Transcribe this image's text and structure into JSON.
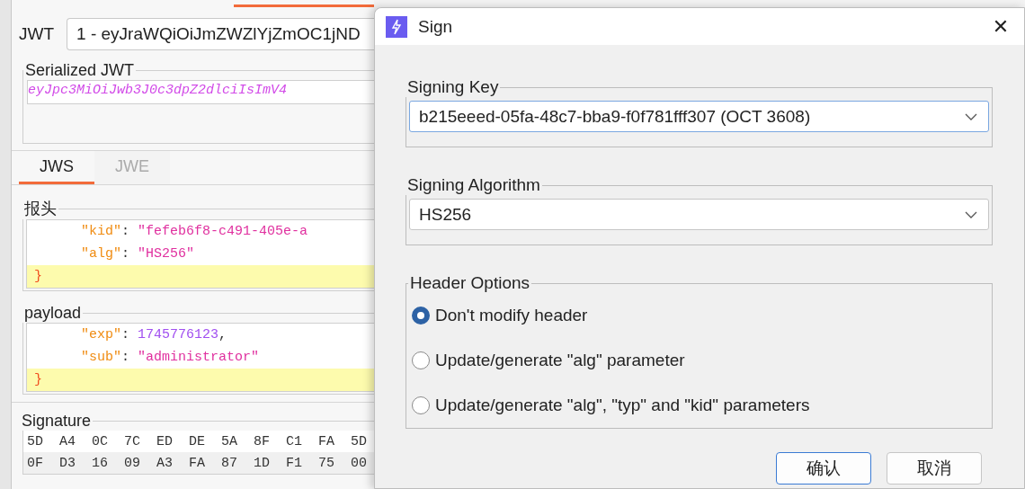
{
  "editor": {
    "jwt_selector": {
      "label": "JWT",
      "value": "1 - eyJraWQiOiJmZWZlYjZmOC1jND"
    },
    "serialized": {
      "title": "Serialized JWT",
      "value": "eyJpc3MiOiJwb3J0c3dpZ2dlciIsImV4"
    },
    "tabs": [
      {
        "label": "JWS",
        "selected": true
      },
      {
        "label": "JWE",
        "selected": false
      }
    ],
    "sections": [
      {
        "title": "报头",
        "lines": [
          {
            "kind": "pair",
            "highlighted": false,
            "tokens": [
              {
                "kind": "key",
                "text": "\"kid\""
              },
              {
                "kind": "punct",
                "text": ":"
              },
              {
                "kind": "string",
                "text": "\"fefeb6f8-c491-405e-a"
              }
            ]
          },
          {
            "kind": "pair",
            "highlighted": false,
            "tokens": [
              {
                "kind": "key",
                "text": "\"alg\""
              },
              {
                "kind": "punct",
                "text": ":"
              },
              {
                "kind": "string",
                "text": "\"HS256\""
              }
            ]
          },
          {
            "kind": "brace",
            "highlighted": true,
            "tokens": [
              {
                "kind": "brace",
                "text": "}"
              }
            ]
          }
        ]
      },
      {
        "title": "payload",
        "lines": [
          {
            "kind": "pair",
            "highlighted": false,
            "tokens": [
              {
                "kind": "key",
                "text": "\"exp\""
              },
              {
                "kind": "punct",
                "text": ":"
              },
              {
                "kind": "number",
                "text": "1745776123"
              },
              {
                "kind": "punct",
                "text": ","
              }
            ]
          },
          {
            "kind": "pair",
            "highlighted": false,
            "tokens": [
              {
                "kind": "key",
                "text": "\"sub\""
              },
              {
                "kind": "punct",
                "text": ":"
              },
              {
                "kind": "string",
                "text": "\"administrator\""
              }
            ]
          },
          {
            "kind": "brace",
            "highlighted": true,
            "tokens": [
              {
                "kind": "brace",
                "text": "}"
              }
            ]
          }
        ]
      }
    ],
    "signature": {
      "title": "Signature",
      "rows": [
        [
          "5D",
          "A4",
          "0C",
          "7C",
          "ED",
          "DE",
          "5A",
          "8F",
          "C1",
          "FA",
          "5D"
        ],
        [
          "0F",
          "D3",
          "16",
          "09",
          "A3",
          "FA",
          "87",
          "1D",
          "F1",
          "75",
          "00"
        ]
      ]
    }
  },
  "dialog": {
    "title": "Sign",
    "close": "✕",
    "signing_key": {
      "title": "Signing Key",
      "value": "b215eeed-05fa-48c7-bba9-f0f781fff307 (OCT 3608)",
      "focused": true
    },
    "signing_algorithm": {
      "title": "Signing Algorithm",
      "value": "HS256",
      "focused": false
    },
    "header_options": {
      "title": "Header Options",
      "options": [
        {
          "label": "Don't modify header",
          "selected": true
        },
        {
          "label": "Update/generate \"alg\" parameter",
          "selected": false
        },
        {
          "label": "Update/generate \"alg\", \"typ\" and \"kid\" parameters",
          "selected": false
        }
      ]
    },
    "buttons": [
      {
        "label": "确认",
        "default": true
      },
      {
        "label": "取消",
        "default": false
      }
    ]
  }
}
